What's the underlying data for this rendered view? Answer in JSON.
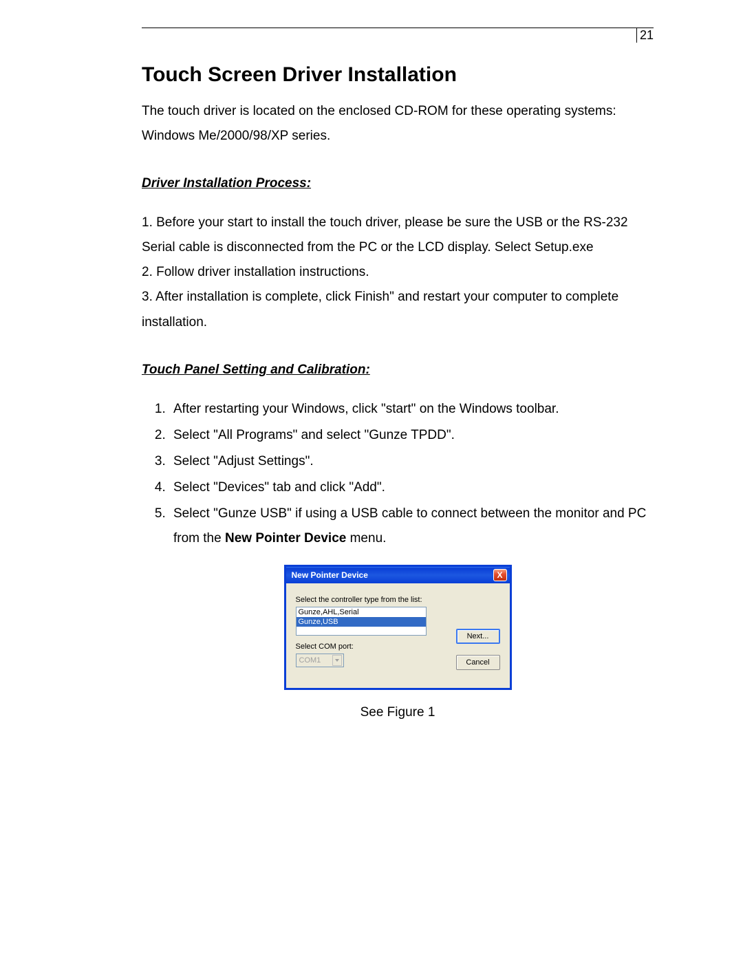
{
  "page_number": "21",
  "title": "Touch Screen Driver Installation",
  "intro": "The touch driver is located on the enclosed CD-ROM for these operating systems: Windows Me/2000/98/XP series.",
  "section1_heading": "Driver Installation Process:",
  "process": {
    "p1": "1. Before your start to install the touch driver, please be sure the USB or the RS-232 Serial cable is disconnected from the PC or the LCD display. Select Setup.exe",
    "p2": "2. Follow driver installation instructions.",
    "p3": "3. After installation is complete, click Finish\" and restart your computer to complete installation."
  },
  "section2_heading": "Touch Panel Setting and Calibration:",
  "calibration": {
    "i1": "After restarting your Windows, click \"start\" on the Windows toolbar.",
    "i2": "Select \"All Programs\" and select \"Gunze TPDD\".",
    "i3": "Select \"Adjust Settings\".",
    "i4": "Select \"Devices\" tab and click \"Add\".",
    "i5_a": "Select \"Gunze USB\" if using a USB cable to connect between the monitor and PC from the ",
    "i5_bold": "New Pointer Device",
    "i5_b": " menu."
  },
  "dialog": {
    "title": "New Pointer Device",
    "close": "X",
    "label_list": "Select the controller type from the list:",
    "list_item_1": "Gunze,AHL,Serial",
    "list_item_2": "Gunze,USB",
    "label_com": "Select COM port:",
    "combo_value": "COM1",
    "btn_next": "Next...",
    "btn_cancel": "Cancel"
  },
  "caption": "See Figure 1"
}
